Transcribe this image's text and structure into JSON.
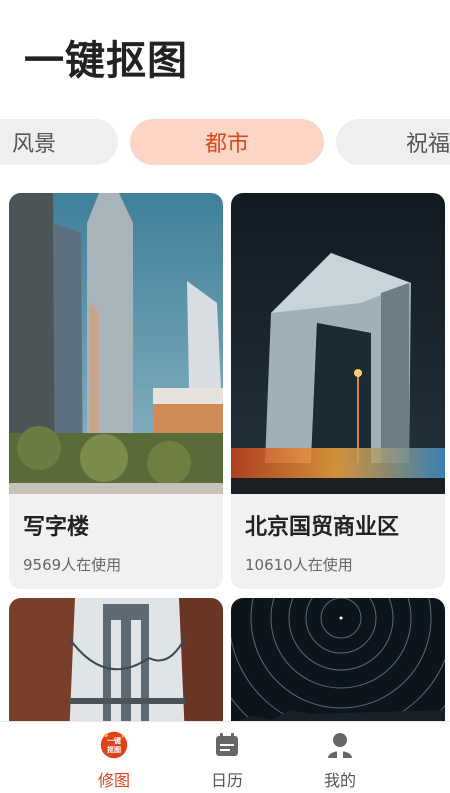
{
  "header": {
    "title": "一键抠图"
  },
  "categories": [
    {
      "label": "风景",
      "active": false
    },
    {
      "label": "都市",
      "active": true
    },
    {
      "label": "祝福",
      "active": false
    }
  ],
  "templates": [
    {
      "name": "写字楼",
      "usage": "9569人在使用"
    },
    {
      "name": "北京国贸商业区",
      "usage": "10610人在使用"
    },
    {
      "name": "",
      "usage": ""
    },
    {
      "name": "",
      "usage": ""
    }
  ],
  "bottom_nav": {
    "items": [
      {
        "label": "修图",
        "icon": "cutout-logo-icon",
        "badge_top": "一键",
        "badge_bottom": "抠图",
        "active": true
      },
      {
        "label": "日历",
        "icon": "calendar-icon",
        "active": false
      },
      {
        "label": "我的",
        "icon": "user-icon",
        "active": false
      }
    ]
  },
  "colors": {
    "accent": "#e0431a",
    "active_tab_bg": "#fdd5c7",
    "inactive_tab_bg": "#efefef"
  }
}
